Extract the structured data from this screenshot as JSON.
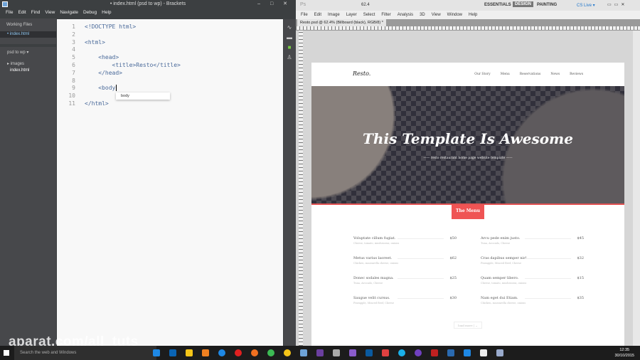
{
  "brackets": {
    "title": "• index.html (psd to wp) - Brackets",
    "menu": [
      "File",
      "Edit",
      "Find",
      "View",
      "Navigate",
      "Debug",
      "Help"
    ],
    "sidebar": {
      "working_files": "Working Files",
      "open_file": "index.html",
      "project": "psd to wp ▾",
      "tree": [
        "▸ images",
        "index.html"
      ]
    },
    "lines": [
      "1",
      "2",
      "3",
      "4",
      "5",
      "6",
      "7",
      "8",
      "9",
      "10",
      "11"
    ],
    "code": [
      "<!DOCTYPE html>",
      "",
      "<html>",
      "",
      "    <head>",
      "        <title>Resto</title>",
      "    </head>",
      "",
      "    <body",
      "",
      "</html>"
    ],
    "hint": "body"
  },
  "photoshop": {
    "zoom": "62.4",
    "workspaces": [
      "ESSENTIALS",
      "DESIGN",
      "PAINTING"
    ],
    "cs_live": "CS Live ▾",
    "menu": [
      "File",
      "Edit",
      "Image",
      "Layer",
      "Select",
      "Filter",
      "Analysis",
      "3D",
      "View",
      "Window",
      "Help"
    ],
    "doc_tab": "Resto.psd @ 62.4% (Billboard (black), RGB/8) *",
    "site": {
      "logo": "Resto.",
      "nav": [
        "Our Story",
        "Menu",
        "Reservations",
        "News",
        "Reviews"
      ],
      "hero_title": "This Template Is Awesome",
      "hero_sub": "resto restaurant home page website template",
      "menu_badge": "The Menu",
      "items": [
        {
          "name": "Voluptate cillum fugiat.",
          "desc": "Cheese, tomato, mushrooms, onions",
          "price": "$50"
        },
        {
          "name": "Arcu pede enim justo.",
          "desc": "Tuna, Avocado, Cheese",
          "price": "$45"
        },
        {
          "name": "Metus varius laoreet.",
          "desc": "Chicken, mozzarella cheese, onions",
          "price": "$62"
        },
        {
          "name": "Cras dapibus semper nisl.",
          "desc": "Pineapple, Minced Beef, Cheese",
          "price": "$32"
        },
        {
          "name": "Donec sodales magna.",
          "desc": "Tuna, Avocado, Cheese",
          "price": "$25"
        },
        {
          "name": "Quam semper libero.",
          "desc": "Cheese, tomato, mushrooms, onions",
          "price": "$15"
        },
        {
          "name": "Saugue velit cursus.",
          "desc": "Pineapple, Minced Beef, Cheese",
          "price": "$30"
        },
        {
          "name": "Nam eget dui Etiam.",
          "desc": "Chicken, mozzarella cheese, onions",
          "price": "$35"
        }
      ],
      "load_more": "load more  |  ⌄"
    }
  },
  "taskbar": {
    "search": "Search the web and Windows",
    "time": "12:35",
    "date": "30/10/2015"
  },
  "watermark": "aparat.com/all_tuts",
  "colors": {
    "accent": "#ef5454",
    "brackets_bg": "#3c3f41"
  }
}
